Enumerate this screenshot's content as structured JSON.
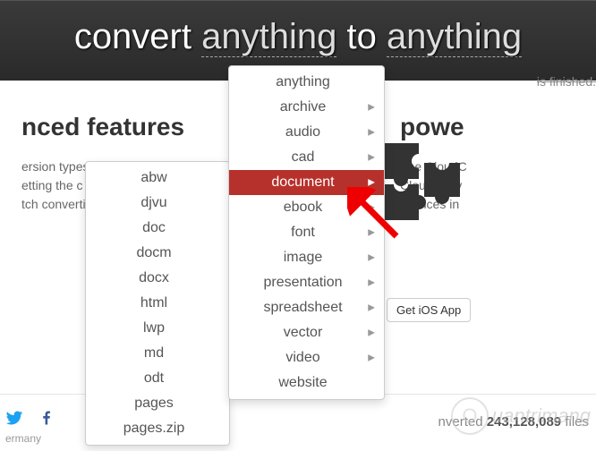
{
  "hero": {
    "prefix": "convert ",
    "kw1": "anything",
    "mid": " to ",
    "kw2": "anything"
  },
  "left": {
    "heading": "nced features",
    "body": "ersion types\netting the c\ntch converti"
  },
  "right": {
    "heading": "powe",
    "body": "The CloudC\nCloudConv\nservices in "
  },
  "finished": "is finished.",
  "main_menu": [
    {
      "label": "anything",
      "arrow": false,
      "active": false
    },
    {
      "label": "archive",
      "arrow": true,
      "active": false
    },
    {
      "label": "audio",
      "arrow": true,
      "active": false
    },
    {
      "label": "cad",
      "arrow": true,
      "active": false
    },
    {
      "label": "document",
      "arrow": true,
      "active": true
    },
    {
      "label": "ebook",
      "arrow": true,
      "active": false
    },
    {
      "label": "font",
      "arrow": true,
      "active": false
    },
    {
      "label": "image",
      "arrow": true,
      "active": false
    },
    {
      "label": "presentation",
      "arrow": true,
      "active": false
    },
    {
      "label": "spreadsheet",
      "arrow": true,
      "active": false
    },
    {
      "label": "vector",
      "arrow": true,
      "active": false
    },
    {
      "label": "video",
      "arrow": true,
      "active": false
    },
    {
      "label": "website",
      "arrow": false,
      "active": false
    }
  ],
  "sub_menu": [
    "abw",
    "djvu",
    "doc",
    "docm",
    "docx",
    "html",
    "lwp",
    "md",
    "odt",
    "pages",
    "pages.zip"
  ],
  "ios_button": "Get iOS App",
  "footer": {
    "location": "ermany",
    "converted_prefix": "nverted ",
    "converted_count": "243,128,089",
    "converted_suffix": " files "
  },
  "watermark": "uantrimang",
  "icons": {
    "puzzle": "puzzle-icon",
    "twitter": "twitter-icon",
    "facebook": "facebook-icon"
  }
}
